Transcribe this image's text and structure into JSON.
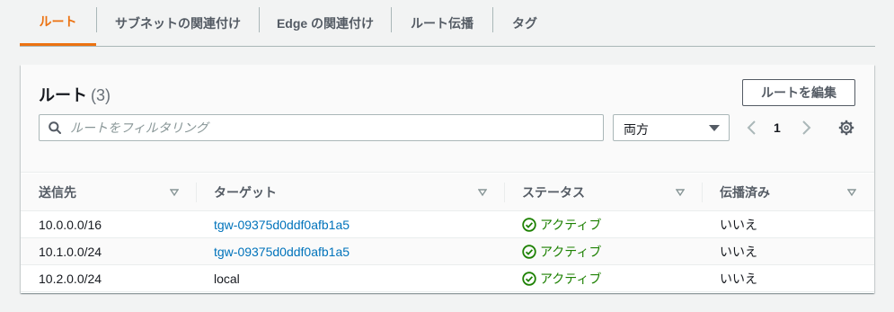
{
  "tabs": [
    {
      "label": "ルート",
      "active": true
    },
    {
      "label": "サブネットの関連付け",
      "active": false
    },
    {
      "label": "Edge の関連付け",
      "active": false
    },
    {
      "label": "ルート伝播",
      "active": false
    },
    {
      "label": "タグ",
      "active": false
    }
  ],
  "panel": {
    "title": "ルート",
    "count": "(3)",
    "edit_button": "ルートを編集",
    "search_placeholder": "ルートをフィルタリング",
    "filter_select": "両方",
    "page_number": "1"
  },
  "table": {
    "columns": [
      "送信先",
      "ターゲット",
      "ステータス",
      "伝播済み"
    ],
    "rows": [
      {
        "destination": "10.0.0.0/16",
        "target": "tgw-09375d0ddf0afb1a5",
        "target_link": true,
        "status": "アクティブ",
        "propagated": "いいえ"
      },
      {
        "destination": "10.1.0.0/24",
        "target": "tgw-09375d0ddf0afb1a5",
        "target_link": true,
        "status": "アクティブ",
        "propagated": "いいえ"
      },
      {
        "destination": "10.2.0.0/24",
        "target": "local",
        "target_link": false,
        "status": "アクティブ",
        "propagated": "いいえ"
      }
    ]
  },
  "colors": {
    "accent": "#ec7211",
    "link": "#0073bb",
    "success": "#1d8102"
  },
  "icons": [
    "search-icon",
    "caret-down-icon",
    "chevron-left-icon",
    "chevron-right-icon",
    "gear-icon",
    "sort-icon",
    "check-circle-icon"
  ]
}
